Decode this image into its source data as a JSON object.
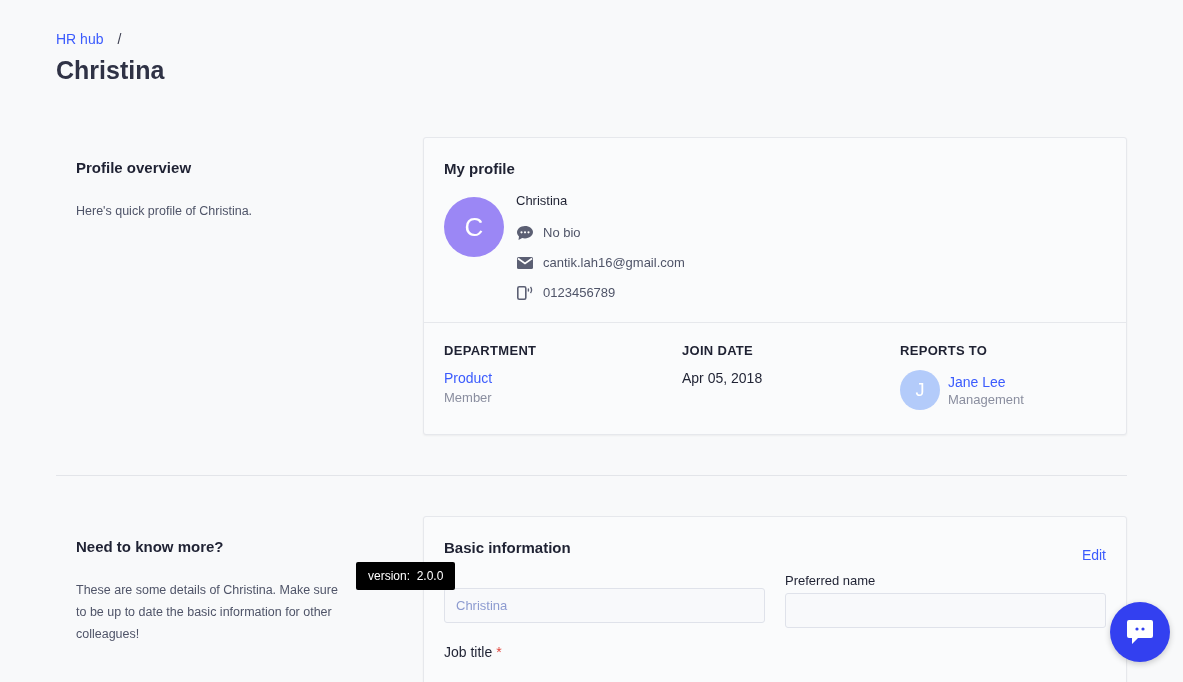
{
  "breadcrumb": [
    {
      "label": "HR hub"
    }
  ],
  "breadcrumb_separator": "/",
  "page_title": "Christina",
  "overview": {
    "title": "Profile overview",
    "description": "Here's quick profile of Christina."
  },
  "profile_card": {
    "title": "My profile",
    "avatar_initial": "C",
    "name": "Christina",
    "details": [
      {
        "kind": "bio",
        "text": "No bio"
      },
      {
        "kind": "email",
        "text": "cantik.lah16@gmail.com"
      },
      {
        "kind": "phone",
        "text": "0123456789"
      }
    ],
    "department": {
      "label": "DEPARTMENT",
      "value": "Product",
      "role": "Member"
    },
    "join_date": {
      "label": "JOIN DATE",
      "value": "Apr 05, 2018"
    },
    "reports_to": {
      "label": "REPORTS TO",
      "avatar_initial": "J",
      "name": "Jane Lee",
      "team": "Management"
    }
  },
  "more": {
    "title": "Need to know more?",
    "description": "These are some details of Christina. Make sure to be up to date the basic information for other colleagues!"
  },
  "basic_card": {
    "title": "Basic information",
    "edit_link": "Edit",
    "fields": [
      {
        "placeholder": "Christina"
      },
      {
        "label": "Preferred name"
      }
    ],
    "job_title": {
      "label": "Job title",
      "required_mark": "*"
    }
  },
  "tooltip": "version:  2.0.0"
}
